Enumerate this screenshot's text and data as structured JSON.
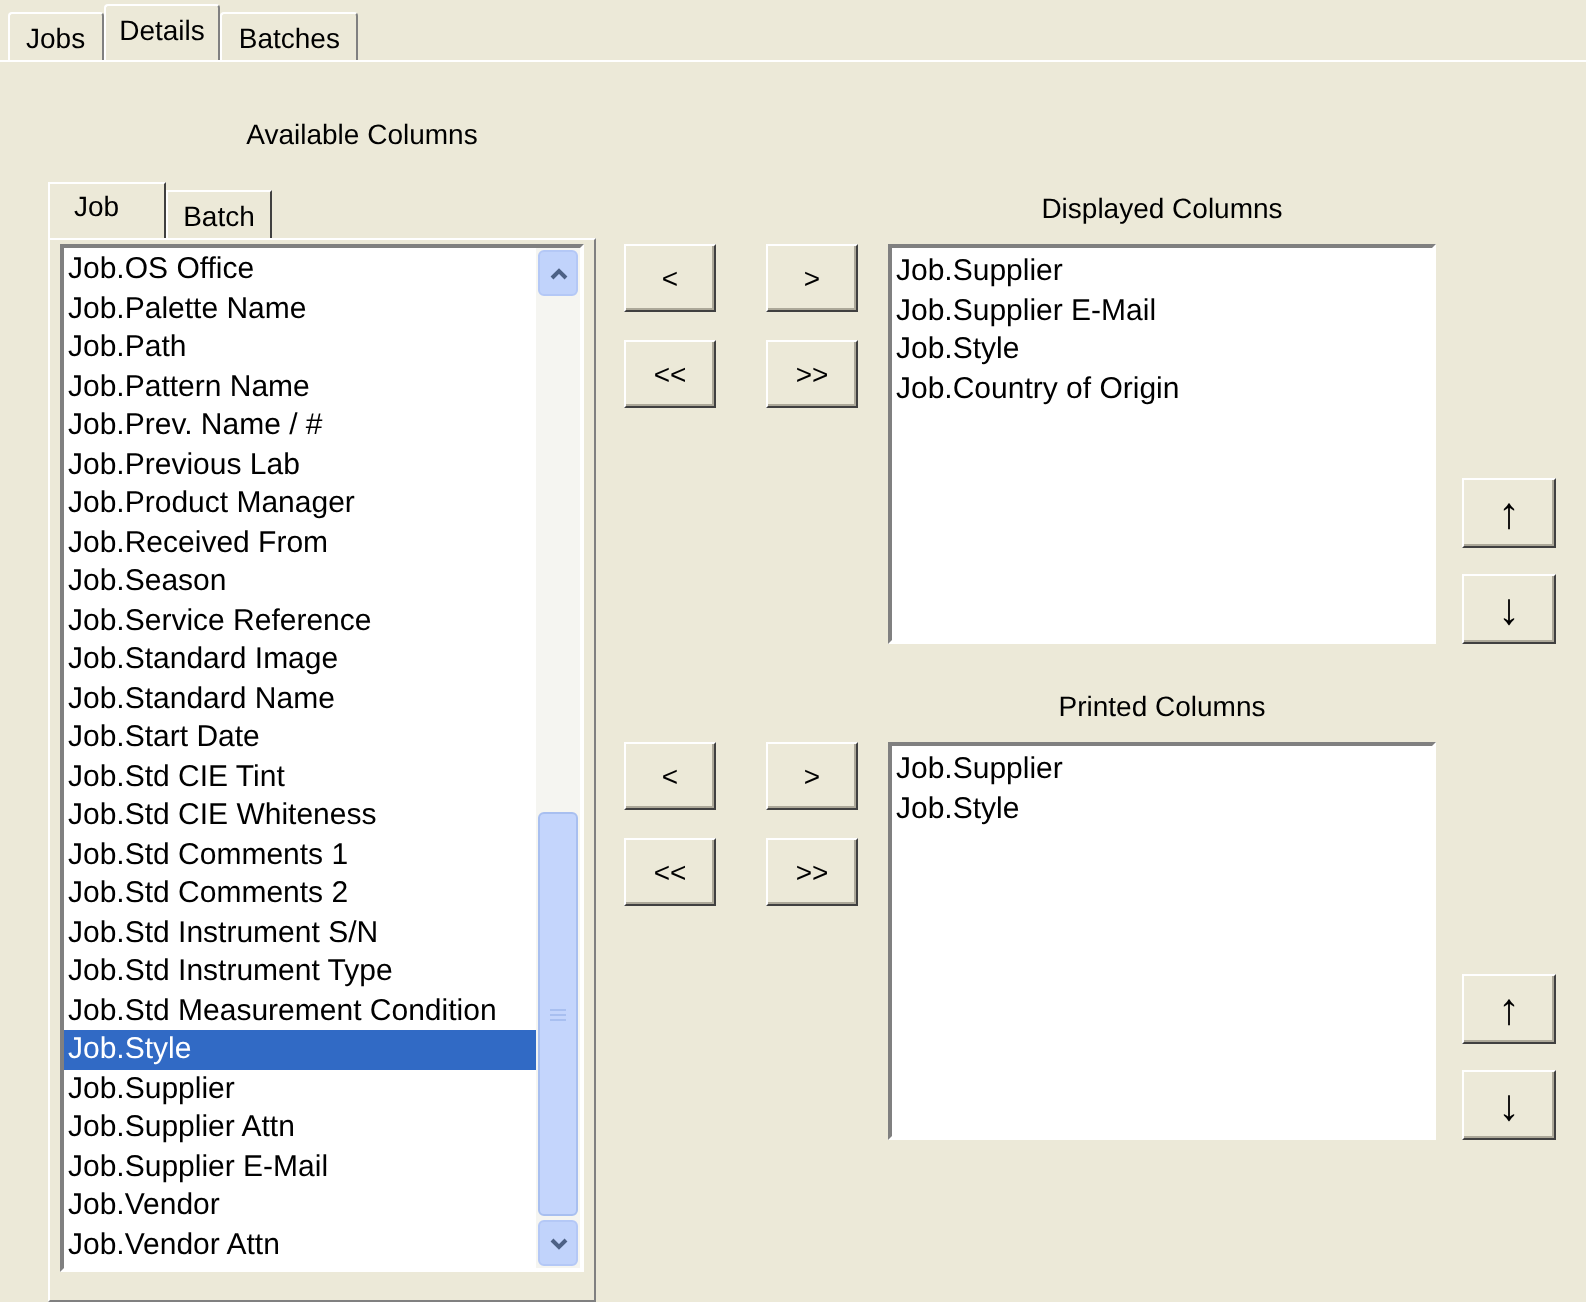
{
  "tabs": [
    {
      "label": "Jobs",
      "selected": false
    },
    {
      "label": "Details",
      "selected": true
    },
    {
      "label": "Batches",
      "selected": false
    }
  ],
  "available": {
    "title": "Available Columns",
    "tabs": [
      {
        "label": "Job",
        "selected": true
      },
      {
        "label": "Batch",
        "selected": false
      }
    ],
    "items": [
      {
        "label": "Job.OS Office",
        "selected": false
      },
      {
        "label": "Job.Palette Name",
        "selected": false
      },
      {
        "label": "Job.Path",
        "selected": false
      },
      {
        "label": "Job.Pattern Name",
        "selected": false
      },
      {
        "label": "Job.Prev. Name / #",
        "selected": false
      },
      {
        "label": "Job.Previous Lab",
        "selected": false
      },
      {
        "label": "Job.Product Manager",
        "selected": false
      },
      {
        "label": "Job.Received From",
        "selected": false
      },
      {
        "label": "Job.Season",
        "selected": false
      },
      {
        "label": "Job.Service Reference",
        "selected": false
      },
      {
        "label": "Job.Standard Image",
        "selected": false
      },
      {
        "label": "Job.Standard Name",
        "selected": false
      },
      {
        "label": "Job.Start Date",
        "selected": false
      },
      {
        "label": "Job.Std CIE Tint",
        "selected": false
      },
      {
        "label": "Job.Std CIE Whiteness",
        "selected": false
      },
      {
        "label": "Job.Std Comments 1",
        "selected": false
      },
      {
        "label": "Job.Std Comments 2",
        "selected": false
      },
      {
        "label": "Job.Std Instrument S/N",
        "selected": false
      },
      {
        "label": "Job.Std Instrument Type",
        "selected": false
      },
      {
        "label": "Job.Std Measurement Condition",
        "selected": false
      },
      {
        "label": "Job.Style",
        "selected": true
      },
      {
        "label": "Job.Supplier",
        "selected": false
      },
      {
        "label": "Job.Supplier Attn",
        "selected": false
      },
      {
        "label": "Job.Supplier E-Mail",
        "selected": false
      },
      {
        "label": "Job.Vendor",
        "selected": false
      },
      {
        "label": "Job.Vendor Attn",
        "selected": false
      }
    ]
  },
  "sections": [
    {
      "title": "Displayed Columns",
      "buttons": [
        "<",
        ">",
        "<<",
        ">>"
      ],
      "items": [
        "Job.Supplier",
        "Job.Supplier E-Mail",
        "Job.Style",
        "Job.Country of Origin"
      ],
      "move_buttons": [
        "↑",
        "↓"
      ]
    },
    {
      "title": "Printed Columns",
      "buttons": [
        "<",
        ">",
        "<<",
        ">>"
      ],
      "items": [
        "Job.Supplier",
        "Job.Style"
      ],
      "move_buttons": [
        "↑",
        "↓"
      ]
    }
  ]
}
